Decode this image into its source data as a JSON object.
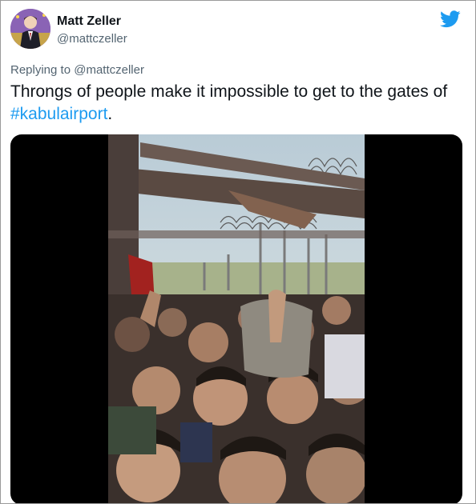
{
  "tweet": {
    "author": {
      "display_name": "Matt Zeller",
      "handle": "@mattczeller",
      "avatar_icon": "avatar-illustration"
    },
    "brand_icon": "twitter-bird-icon",
    "reply_prefix": "Replying to",
    "reply_handle": "@mattczeller",
    "text_before": "Throngs of people make it impossible to get to the gates of ",
    "hashtag": "#kabulairport",
    "text_after": ".",
    "media": {
      "type": "video",
      "subject": "crowd-at-fence-photo"
    }
  },
  "colors": {
    "accent": "#1d9bf0",
    "text": "#0f1419",
    "secondary": "#536471",
    "media_bg": "#000000"
  }
}
